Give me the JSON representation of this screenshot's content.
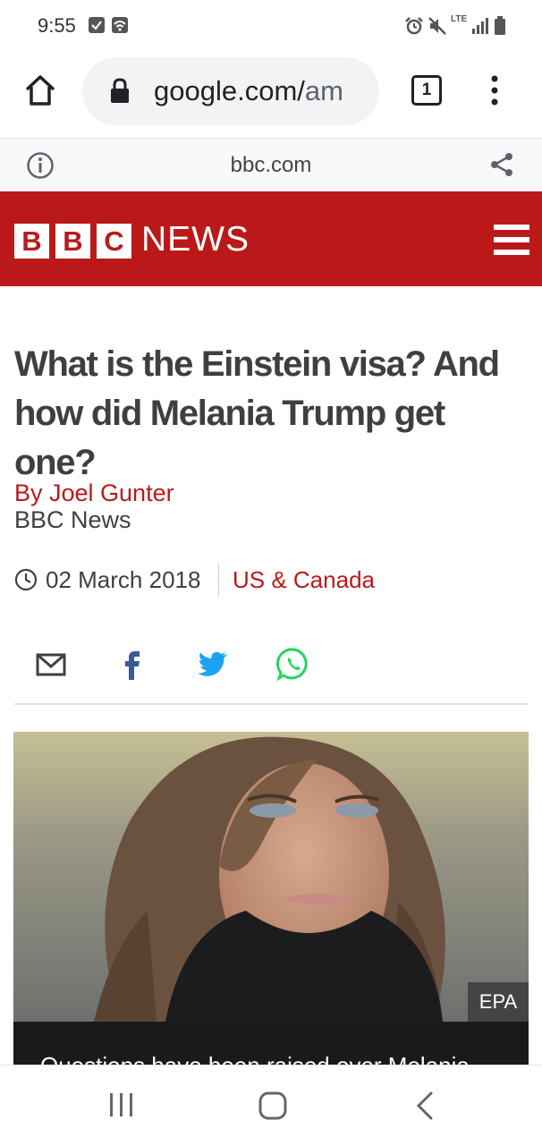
{
  "status_bar": {
    "time": "9:55",
    "network_label": "LTE"
  },
  "browser": {
    "url_host": "google.com/",
    "url_rest": "am",
    "tab_count": "1"
  },
  "amp_bar": {
    "domain": "bbc.com"
  },
  "site": {
    "logo_letters": [
      "B",
      "B",
      "C"
    ],
    "logo_word": "NEWS",
    "brand_color": "#bb1919"
  },
  "article": {
    "headline": "What is the Einstein visa? And how did Melania Trump get one?",
    "byline": "By Joel Gunter",
    "source": "BBC News",
    "date": "02 March 2018",
    "section": "US & Canada",
    "image_credit": "EPA",
    "caption": "Questions have been raised over Melania"
  },
  "share_icons": [
    "email-icon",
    "facebook-icon",
    "twitter-icon",
    "whatsapp-icon"
  ],
  "nav_icons": [
    "recent-apps-icon",
    "home-icon",
    "back-icon"
  ]
}
